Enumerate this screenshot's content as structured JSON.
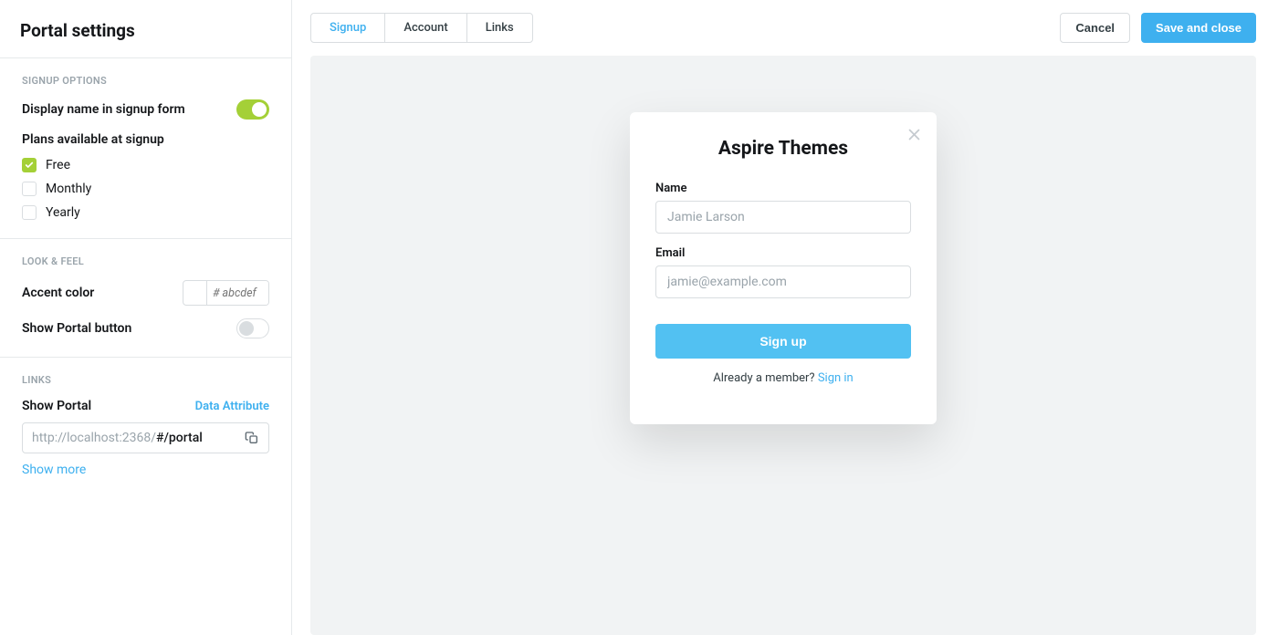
{
  "page_title": "Portal settings",
  "sidebar": {
    "sections": {
      "signup_options": {
        "title": "SIGNUP OPTIONS",
        "display_name_label": "Display name in signup form",
        "display_name_on": true,
        "plans_label": "Plans available at signup",
        "plans": [
          {
            "label": "Free",
            "checked": true
          },
          {
            "label": "Monthly",
            "checked": false
          },
          {
            "label": "Yearly",
            "checked": false
          }
        ]
      },
      "look_feel": {
        "title": "LOOK & FEEL",
        "accent_label": "Accent color",
        "accent_placeholder": "# abcdef",
        "portal_button_label": "Show Portal button",
        "portal_button_on": false
      },
      "links": {
        "title": "LINKS",
        "show_portal_label": "Show Portal",
        "data_attr_label": "Data Attribute",
        "url_prefix": "http://localhost:2368/",
        "url_hash": "#/portal",
        "show_more_label": "Show more"
      }
    }
  },
  "tabs": {
    "items": [
      {
        "label": "Signup",
        "active": true
      },
      {
        "label": "Account",
        "active": false
      },
      {
        "label": "Links",
        "active": false
      }
    ]
  },
  "actions": {
    "cancel": "Cancel",
    "save": "Save and close"
  },
  "preview": {
    "brand": "Aspire Themes",
    "name_label": "Name",
    "name_placeholder": "Jamie Larson",
    "email_label": "Email",
    "email_placeholder": "jamie@example.com",
    "signup_button": "Sign up",
    "already_text": "Already a member? ",
    "signin_link": "Sign in"
  }
}
